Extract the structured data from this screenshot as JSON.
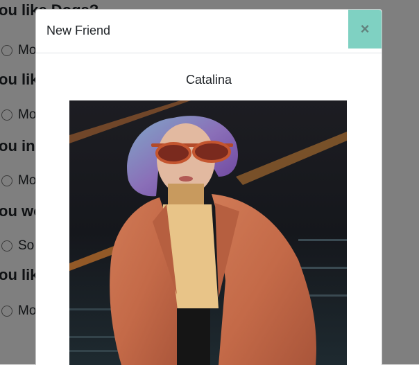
{
  "background": {
    "questions": [
      {
        "text": "ou like Dogs?",
        "option": "Mo"
      },
      {
        "text": "ou lik",
        "option": "Mo"
      },
      {
        "text": "ou in",
        "option": "Mo"
      },
      {
        "text": "ou wo",
        "option": "So"
      },
      {
        "text": "ou lik",
        "option": "Mo"
      }
    ]
  },
  "modal": {
    "title": "New Friend",
    "close_symbol": "×",
    "friend_name": "Catalina",
    "photo_alt": "Catalina"
  },
  "colors": {
    "close_button_bg": "#7fd1c2",
    "backdrop": "rgba(0,0,0,0.5)"
  }
}
